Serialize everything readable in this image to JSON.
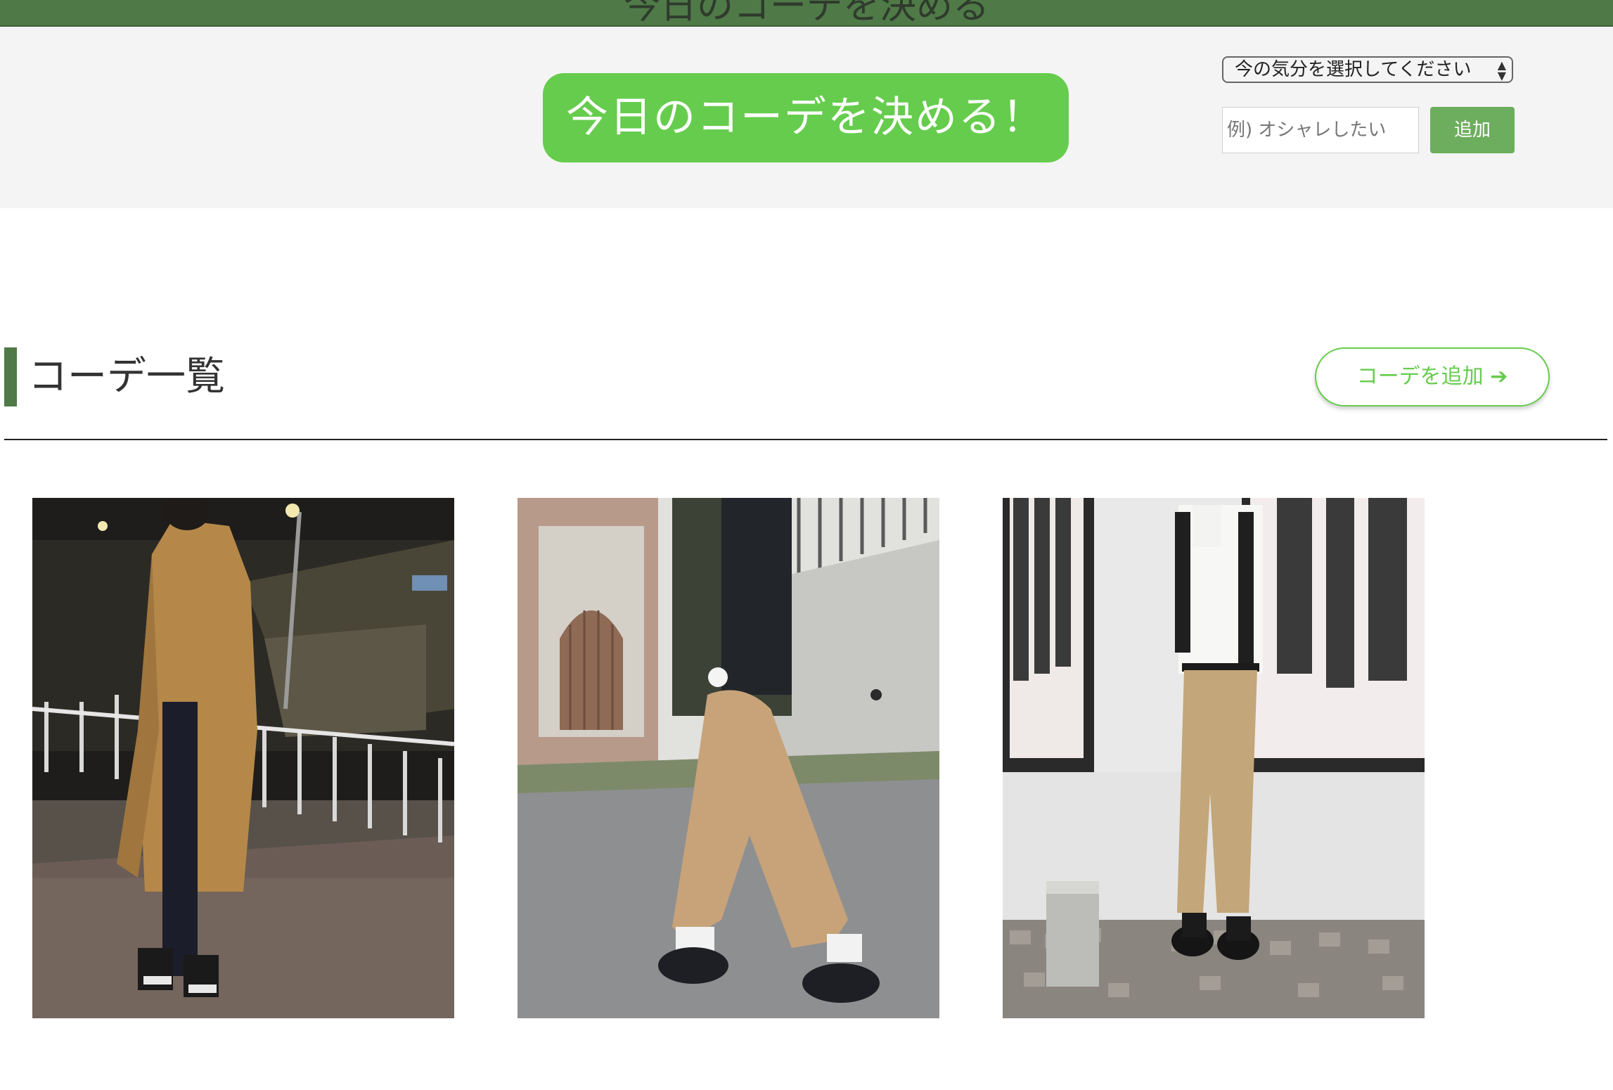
{
  "header": {
    "title": "今日のコーデを決める"
  },
  "hero": {
    "decide_label": "今日のコーデを決める！",
    "mood_select_selected": "今の気分を選択してください",
    "mood_input_placeholder": "例) オシャレしたい",
    "add_label": "追加"
  },
  "section": {
    "title": "コーデ一覧",
    "add_code_label": "コーデを追加",
    "add_code_icon": "arrow-right-icon"
  },
  "outfits": [
    {
      "name": "outfit-photo-1"
    },
    {
      "name": "outfit-photo-2"
    },
    {
      "name": "outfit-photo-3"
    }
  ],
  "colors": {
    "header_green": "#4f7a48",
    "accent_green": "#66cc4d",
    "add_button_green": "#6dae5e",
    "hero_background": "#f4f4f4"
  }
}
